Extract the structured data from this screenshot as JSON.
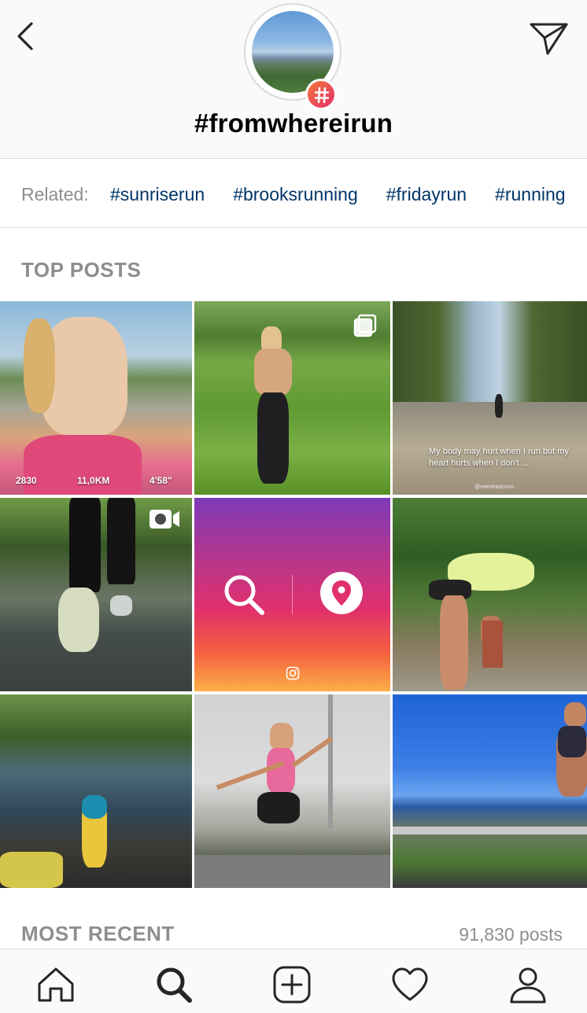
{
  "header": {
    "tag_title": "#fromwhereirun"
  },
  "related": {
    "label": "Related:",
    "tags": [
      "#sunriserun",
      "#brooksrunning",
      "#fridayrun",
      "#running"
    ]
  },
  "sections": {
    "top_posts": "TOP POSTS",
    "most_recent": "MOST RECENT",
    "post_count": "91,830 posts"
  },
  "posts": {
    "p1": {
      "stat_a": "2830",
      "stat_b": "11,0KM",
      "stat_c": "4'58\""
    },
    "p3": {
      "quote": "My body may hurt when I run but my heart hurts when I don't ...",
      "credit": "@mientrascorro"
    }
  },
  "icons": {
    "back": "chevron-left-icon",
    "direct": "paper-plane-icon",
    "home": "home-icon",
    "search": "search-icon",
    "new_post": "plus-square-icon",
    "activity": "heart-icon",
    "profile": "person-icon"
  },
  "colors": {
    "link": "#003569",
    "muted": "#8e8e8e",
    "badge_start": "#f77737",
    "badge_end": "#e1306c"
  }
}
